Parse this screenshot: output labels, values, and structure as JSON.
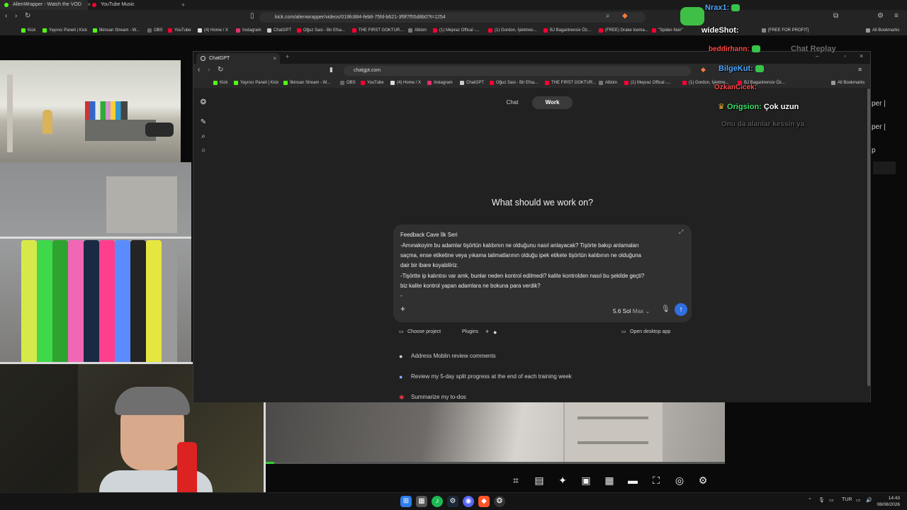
{
  "outer_browser": {
    "tabs": [
      "AlienWrapper - Watch the VOD",
      "YouTube Music"
    ],
    "url": "kick.com/alienwrapper/videos/019fc884-feb8-75fd-b621-3f9f7f55d8b0?t=1254",
    "bookmarks": [
      "Kick",
      "Yayıncı Paneli | Kick",
      "İlkinsan Stream - W...",
      "OBS",
      "YouTube",
      "(4) Home / X",
      "Instagram",
      "ChatGPT",
      "Oğuz Sasi - Bir Efsa...",
      "THE FIRST GOKTUR...",
      "Albüm",
      "(1) Mepraz Offical -...",
      "(1) Gordon, İşletmec...",
      "BJ Bagantrensiv Öz...",
      "(FREE) Drake Icema...",
      "\"Spider-Noir\"",
      "[FREE FOR PROFIT]"
    ],
    "all_bookmarks": "All Bookmarks"
  },
  "inner_browser": {
    "tab": "ChatGPT",
    "url": "chatgpt.com",
    "bookmarks": [
      "Kick",
      "Yayıncı Paneli | Kick",
      "İlkinsan Stream - W...",
      "OBS",
      "YouTube",
      "(4) Home / X",
      "Instagram",
      "ChatGPT",
      "Oğuz Sasi - Bir Efsa...",
      "THE FIRST GOKTUR...",
      "Albüm",
      "(1) Mepraz Offical -...",
      "(1) Gordon, İşletme...",
      "BJ Bagantrensiv Öz..."
    ],
    "all_bookmarks": "All Bookmarks"
  },
  "chatgpt": {
    "mode_chat": "Chat",
    "mode_work": "Work",
    "headline": "What should we work on?",
    "composer_lines": [
      "Feedback Cave İlk Seri",
      "-Amınakoyim bu adamlar tişörtün kalıbının ne olduğunu nasıl anlayacak? Tişörte bakıp anlamaları",
      "saçma, ense etiketine veya yıkama talimatlarının olduğu ipek etikete tişörtün kalıbının ne olduğuna",
      "dair bir ibare koyabiliriz.",
      "-Tişörtte ip kalıntısı var amk, bunlar neden kontrol edilmedi? kalite kontrolden nasıl bu şekilde geçti?",
      "biz kalite kontrol yapan adamlara ne bokuna para verdik?",
      "-"
    ],
    "model": "5.6 Sol",
    "model_level": "Max",
    "choose_project": "Choose project",
    "plugins": "Plugins",
    "open_desktop": "Open desktop app",
    "suggestions": [
      "Address Moblin review comments",
      "Review my 5-day split progress at the end of each training week",
      "Summarize my to-dos"
    ]
  },
  "stream_chat": {
    "title": "Chat Replay",
    "messages": [
      {
        "user": "Nrax1:",
        "color": "#4fa8ff",
        "text": ""
      },
      {
        "user": "wideShot:",
        "color": "#ffffff",
        "text": ""
      },
      {
        "user": "beddirhann:",
        "color": "#ff4b4b",
        "text": ""
      },
      {
        "user": "BilgeKut:",
        "color": "#4fa8ff",
        "text": ""
      },
      {
        "user": "OzkanCicek:",
        "color": "#ff4b4b",
        "text": ""
      },
      {
        "user": "Origsion:",
        "color": "#3ee06a",
        "text": "Çok uzun"
      },
      {
        "user": "",
        "color": "#888888",
        "text": "Onu da alanlar kessin ya"
      }
    ],
    "side_fragments": [
      "per |",
      "per |",
      "p"
    ]
  },
  "taskbar": {
    "lang": "TUR",
    "time": "14:43",
    "date": "08/08/2026"
  },
  "colors": {
    "accent_send": "#2f6fe0",
    "emote_green": "#37c44a"
  }
}
